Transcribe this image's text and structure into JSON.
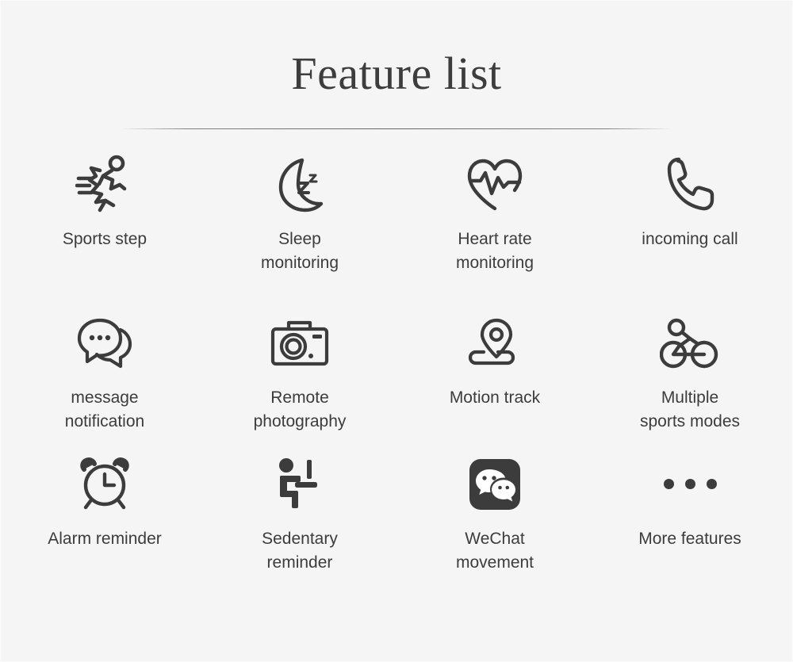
{
  "header": {
    "title": "Feature list"
  },
  "colors": {
    "background": "#f5f5f5",
    "text": "#3c3c3c",
    "icon": "#3c3c3c",
    "divider": "#6e6e6e"
  },
  "features": [
    {
      "id": "sports-step",
      "label": "Sports step",
      "icon": "running-person-icon",
      "row": 1,
      "column": 1
    },
    {
      "id": "sleep-monitoring",
      "label": "Sleep\nmonitoring",
      "icon": "crescent-moon-zzz-icon",
      "row": 1,
      "column": 2
    },
    {
      "id": "heart-rate-monitoring",
      "label": "Heart rate\nmonitoring",
      "icon": "heart-pulse-icon",
      "row": 1,
      "column": 3
    },
    {
      "id": "incoming-call",
      "label": "incoming call",
      "icon": "phone-handset-icon",
      "row": 1,
      "column": 4
    },
    {
      "id": "message-notification",
      "label": "message\nnotification",
      "icon": "chat-bubbles-icon",
      "row": 2,
      "column": 1
    },
    {
      "id": "remote-photography",
      "label": "Remote\nphotography",
      "icon": "camera-icon",
      "row": 2,
      "column": 2
    },
    {
      "id": "motion-track",
      "label": "Motion track",
      "icon": "map-pin-path-icon",
      "row": 2,
      "column": 3
    },
    {
      "id": "multiple-sports-modes",
      "label": "Multiple\nsports modes",
      "icon": "bicycle-icon",
      "row": 2,
      "column": 4
    },
    {
      "id": "alarm-reminder",
      "label": "Alarm reminder",
      "icon": "alarm-clock-icon",
      "row": 3,
      "column": 1
    },
    {
      "id": "sedentary-reminder",
      "label": "Sedentary\nreminder",
      "icon": "seated-person-desk-icon",
      "row": 3,
      "column": 2
    },
    {
      "id": "wechat-movement",
      "label": "WeChat\nmovement",
      "icon": "wechat-logo-icon",
      "row": 3,
      "column": 3
    },
    {
      "id": "more-features",
      "label": "More features",
      "icon": "ellipsis-dots-icon",
      "row": 3,
      "column": 4
    }
  ]
}
